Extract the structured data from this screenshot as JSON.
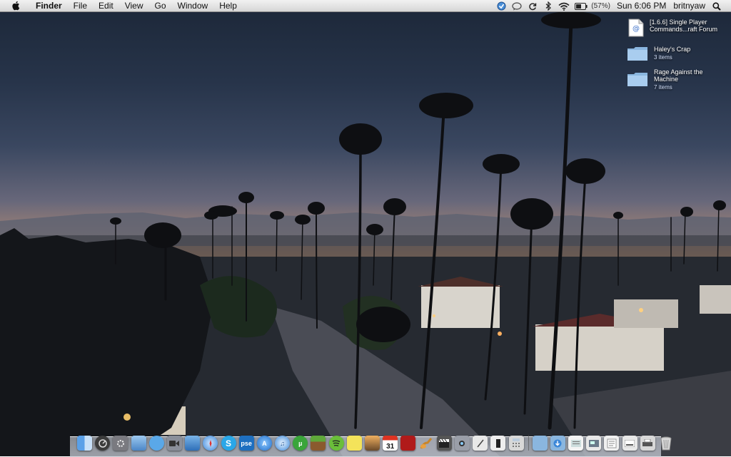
{
  "menubar": {
    "app_name": "Finder",
    "menus": [
      "File",
      "Edit",
      "View",
      "Go",
      "Window",
      "Help"
    ],
    "battery_percent": "(57%)",
    "clock": "Sun 6:06 PM",
    "user": "britnyaw"
  },
  "desktop": {
    "items": [
      {
        "name": "[1.6.6] Single Player Commands...raft Forum",
        "sub": "",
        "icon": "webloc-icon"
      },
      {
        "name": "Haley's Crap",
        "sub": "3 items",
        "icon": "folder-icon"
      },
      {
        "name": "Rage Against the Machine",
        "sub": "7 items",
        "icon": "folder-icon"
      }
    ]
  },
  "dock": {
    "apps": [
      "finder-icon",
      "dashboard-icon",
      "system-preferences-icon",
      "preview-icon",
      "ichat-icon",
      "facetime-icon",
      "mission-control-icon",
      "safari-icon",
      "skype-icon",
      "photoshop-elements-icon",
      "app-store-icon",
      "itunes-icon",
      "utorrent-icon",
      "minecraft-icon",
      "spotify-icon",
      "stickies-icon",
      "iphoto-icon",
      "ical-icon",
      "photo-booth-icon",
      "garageband-icon",
      "imovie-icon",
      "image-capture-icon",
      "textedit-icon",
      "automator-icon",
      "calculator-icon"
    ],
    "docs": [
      "applications-folder-icon",
      "downloads-folder-icon",
      "document-stack-icon",
      "screenshot-stack-icon",
      "preferences-stack-icon",
      "screenshot-2-icon",
      "printer-icon",
      "trash-icon"
    ],
    "photoshop_label": "pse"
  },
  "colors": {
    "sky_top": "#1c2738",
    "horizon_glow": "#e8a55f",
    "menubar_bg": "#e4e4e4"
  }
}
